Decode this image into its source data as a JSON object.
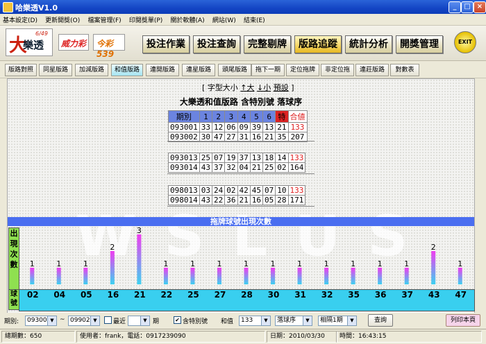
{
  "window": {
    "title": "哈樂透V1.0",
    "min": "_",
    "max": "□",
    "close": "×"
  },
  "menu": [
    "基本設定(D)",
    "更新開獎(O)",
    "檔案管理(F)",
    "印閱獎單(P)",
    "關於軟體(A)",
    "網站(W)",
    "結束(E)"
  ],
  "logos": {
    "lotto": {
      "big": "大",
      "text": "樂透",
      "small": "6/49"
    },
    "power": "威力彩",
    "today": "今彩539"
  },
  "main_buttons": [
    "投注作業",
    "投注查詢",
    "完整剔牌",
    "版路追蹤",
    "統計分析",
    "開獎管理"
  ],
  "main_active": 3,
  "exit_label": "EXIT",
  "sub_buttons": [
    "版路對照",
    "同星版路",
    "加減版路",
    "和值版路",
    "連開版路",
    "連星版路",
    "頭尾版路",
    "拖下一期",
    "定位拖牌",
    "非定位拖",
    "連莊版路",
    "對數表"
  ],
  "sub_active": 3,
  "font_control": {
    "left": "[",
    "label": "字型大小",
    "bigger": "↑大",
    "smaller": "↓小",
    "default": "預設",
    "right": "]"
  },
  "report_title": "大樂透和值版路 含特別號 落球序",
  "table_header": [
    "期別",
    "1",
    "2",
    "3",
    "4",
    "5",
    "6",
    "特",
    "合値"
  ],
  "groups": [
    [
      [
        "093001",
        "33",
        "12",
        "06",
        "09",
        "39",
        "13",
        "21",
        "133"
      ],
      [
        "093002",
        "30",
        "47",
        "27",
        "31",
        "16",
        "21",
        "35",
        "207"
      ]
    ],
    [
      [
        "093013",
        "25",
        "07",
        "19",
        "37",
        "13",
        "18",
        "14",
        "133"
      ],
      [
        "093014",
        "43",
        "37",
        "32",
        "04",
        "21",
        "25",
        "02",
        "164"
      ]
    ],
    [
      [
        "098013",
        "03",
        "24",
        "02",
        "42",
        "45",
        "07",
        "10",
        "133"
      ],
      [
        "098014",
        "43",
        "22",
        "36",
        "21",
        "16",
        "05",
        "28",
        "171"
      ]
    ]
  ],
  "chart_data": {
    "type": "bar",
    "title": "拖牌球號出現次數",
    "ylabel": "出現次數",
    "xlabel": "球號",
    "categories": [
      "02",
      "04",
      "05",
      "16",
      "21",
      "22",
      "25",
      "27",
      "28",
      "30",
      "31",
      "32",
      "35",
      "36",
      "37",
      "43",
      "47"
    ],
    "values": [
      1,
      1,
      1,
      2,
      3,
      1,
      1,
      1,
      1,
      1,
      1,
      1,
      1,
      1,
      1,
      2,
      1
    ],
    "ylim": [
      0,
      3
    ],
    "colors": {
      "bar_top": "#f03cf0",
      "bar_bottom": "#3cd2f0",
      "axis_row": "#39cfef",
      "title_bar": "#4a6ef0"
    }
  },
  "filters": {
    "period_label": "期別:",
    "from": "093001",
    "tilde": "~",
    "to": "099025",
    "recent_label": "最近",
    "recent_value": "",
    "period_unit": "期",
    "special_label": "含特別號",
    "sum_label": "和值",
    "sum_value": "133",
    "order_value": "落球序",
    "interval_value": "相隔1期",
    "query_button": "查詢",
    "print_button": "列印本頁"
  },
  "status": {
    "total": "總期數：650",
    "user": "使用者：frank，電話：0917239090",
    "date": "日期：2010/03/30",
    "time": "時間：16:43:15"
  }
}
